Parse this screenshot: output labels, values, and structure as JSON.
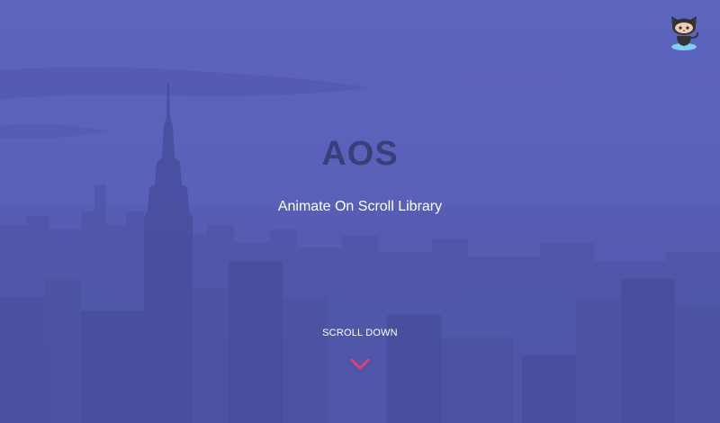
{
  "hero": {
    "title": "AOS",
    "subtitle": "Animate On Scroll Library",
    "scroll_label": "SCROLL DOWN"
  },
  "icons": {
    "github": "octocat-icon",
    "scroll": "chevron-down-icon"
  },
  "colors": {
    "overlay": "#5a60b8",
    "title": "#3a3f7a",
    "accent": "#e0407a"
  }
}
